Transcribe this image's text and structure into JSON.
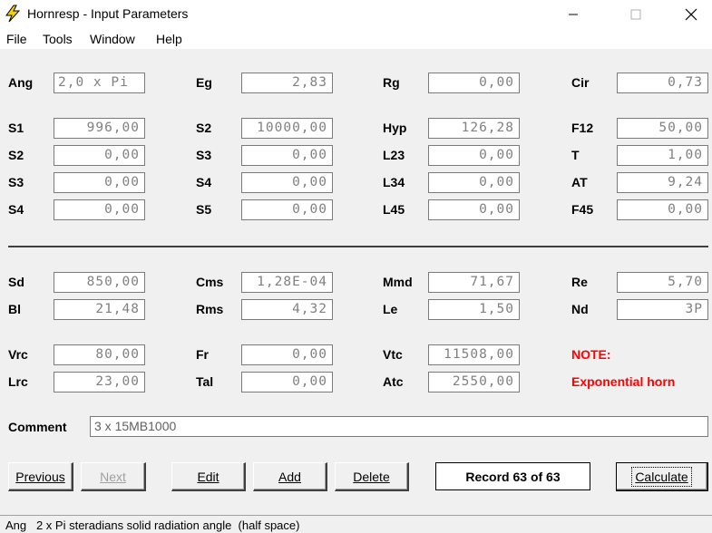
{
  "window": {
    "title": "Hornresp - Input Parameters"
  },
  "menu": [
    "File",
    "Tools",
    "Window",
    "Help"
  ],
  "grid": {
    "row1": [
      {
        "label": "Ang",
        "value": "2,0 x Pi"
      },
      {
        "label": "Eg",
        "value": "2,83"
      },
      {
        "label": "Rg",
        "value": "0,00"
      },
      {
        "label": "Cir",
        "value": "0,73"
      }
    ],
    "row2": [
      {
        "label": "S1",
        "value": "996,00"
      },
      {
        "label": "S2",
        "value": "10000,00"
      },
      {
        "label": "Hyp",
        "value": "126,28"
      },
      {
        "label": "F12",
        "value": "50,00"
      }
    ],
    "row3": [
      {
        "label": "S2",
        "value": "0,00"
      },
      {
        "label": "S3",
        "value": "0,00"
      },
      {
        "label": "L23",
        "value": "0,00"
      },
      {
        "label": "T",
        "value": "1,00"
      }
    ],
    "row4": [
      {
        "label": "S3",
        "value": "0,00"
      },
      {
        "label": "S4",
        "value": "0,00"
      },
      {
        "label": "L34",
        "value": "0,00"
      },
      {
        "label": "AT",
        "value": "9,24"
      }
    ],
    "row5": [
      {
        "label": "S4",
        "value": "0,00"
      },
      {
        "label": "S5",
        "value": "0,00"
      },
      {
        "label": "L45",
        "value": "0,00"
      },
      {
        "label": "F45",
        "value": "0,00"
      }
    ],
    "row6": [
      {
        "label": "Sd",
        "value": "850,00"
      },
      {
        "label": "Cms",
        "value": "1,28E-04"
      },
      {
        "label": "Mmd",
        "value": "71,67"
      },
      {
        "label": "Re",
        "value": "5,70"
      }
    ],
    "row7": [
      {
        "label": "Bl",
        "value": "21,48"
      },
      {
        "label": "Rms",
        "value": "4,32"
      },
      {
        "label": "Le",
        "value": "1,50"
      },
      {
        "label": "Nd",
        "value": "3P"
      }
    ],
    "row8": [
      {
        "label": "Vrc",
        "value": "80,00"
      },
      {
        "label": "Fr",
        "value": "0,00"
      },
      {
        "label": "Vtc",
        "value": "11508,00"
      }
    ],
    "row9": [
      {
        "label": "Lrc",
        "value": "23,00"
      },
      {
        "label": "Tal",
        "value": "0,00"
      },
      {
        "label": "Atc",
        "value": "2550,00"
      }
    ]
  },
  "note": {
    "title": "NOTE:",
    "text": "Exponential horn"
  },
  "comment": {
    "label": "Comment",
    "value": "3 x 15MB1000"
  },
  "buttons": {
    "previous": "Previous",
    "next": "Next",
    "edit": "Edit",
    "add": "Add",
    "delete": "Delete",
    "calculate": "Calculate"
  },
  "record": "Record 63 of 63",
  "status": "Ang   2 x Pi steradians solid radiation angle  (half space)",
  "colors": {
    "note": "#ff0000",
    "window_bg": "#f0f0f0",
    "field_text": "#808080",
    "app_icon": "#f5d000"
  }
}
